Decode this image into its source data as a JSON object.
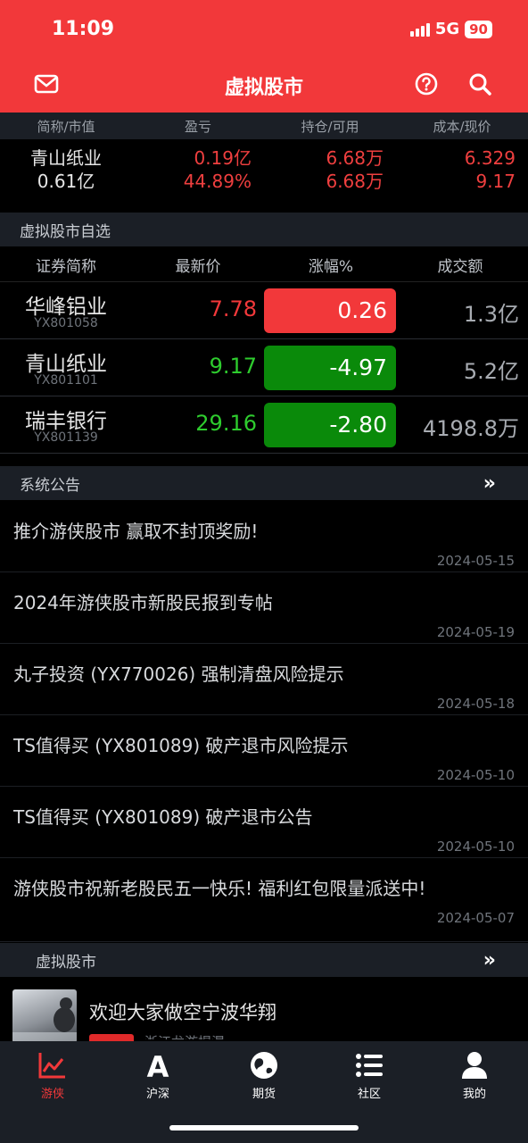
{
  "status": {
    "time": "11:09",
    "network": "5G",
    "battery": "90"
  },
  "header": {
    "title": "虚拟股市"
  },
  "holdings": {
    "columns": [
      "简称/市值",
      "盈亏",
      "持仓/可用",
      "成本/现价"
    ],
    "row": {
      "name": "青山纸业",
      "market_value": "0.61亿",
      "pnl": "0.19亿",
      "pnl_pct": "44.89%",
      "position": "6.68万",
      "available": "6.68万",
      "cost": "6.329",
      "current": "9.17"
    }
  },
  "watchlist": {
    "title": "虚拟股市自选",
    "columns": [
      "证券简称",
      "最新价",
      "涨幅%",
      "成交额"
    ],
    "rows": [
      {
        "name": "华峰铝业",
        "code": "YX801058",
        "price": "7.78",
        "change": "0.26",
        "volume": "1.3亿"
      },
      {
        "name": "青山纸业",
        "code": "YX801101",
        "price": "9.17",
        "change": "-4.97",
        "volume": "5.2亿"
      },
      {
        "name": "瑞丰银行",
        "code": "YX801139",
        "price": "29.16",
        "change": "-2.80",
        "volume": "4198.8万"
      }
    ],
    "up_color": "#f2383a",
    "down_color": "#0a8a0a"
  },
  "announcements": {
    "title": "系统公告",
    "items": [
      {
        "text": "推介游侠股市 赢取不封顶奖励!",
        "date": "2024-05-15"
      },
      {
        "text": "2024年游侠股市新股民报到专帖",
        "date": "2024-05-19"
      },
      {
        "text": "丸子投资 (YX770026) 强制清盘风险提示",
        "date": "2024-05-18"
      },
      {
        "text": "TS值得买 (YX801089) 破产退市风险提示",
        "date": "2024-05-10"
      },
      {
        "text": "TS值得买 (YX801089) 破产退市公告",
        "date": "2024-05-10"
      },
      {
        "text": "游侠股市祝新老股民五一快乐! 福利红包限量派送中!",
        "date": "2024-05-07"
      }
    ]
  },
  "news": {
    "title": "虚拟股市",
    "item": {
      "title": "欢迎大家做空宁波华翔",
      "source": "浙江龙游揭瀑"
    }
  },
  "tabs": [
    {
      "label": "游侠",
      "icon": "chart-icon",
      "active": true
    },
    {
      "label": "沪深",
      "icon": "letter-a-icon",
      "active": false
    },
    {
      "label": "期货",
      "icon": "globe-icon",
      "active": false
    },
    {
      "label": "社区",
      "icon": "list-icon",
      "active": false
    },
    {
      "label": "我的",
      "icon": "person-icon",
      "active": false
    }
  ],
  "accent_color": "#f2383a"
}
